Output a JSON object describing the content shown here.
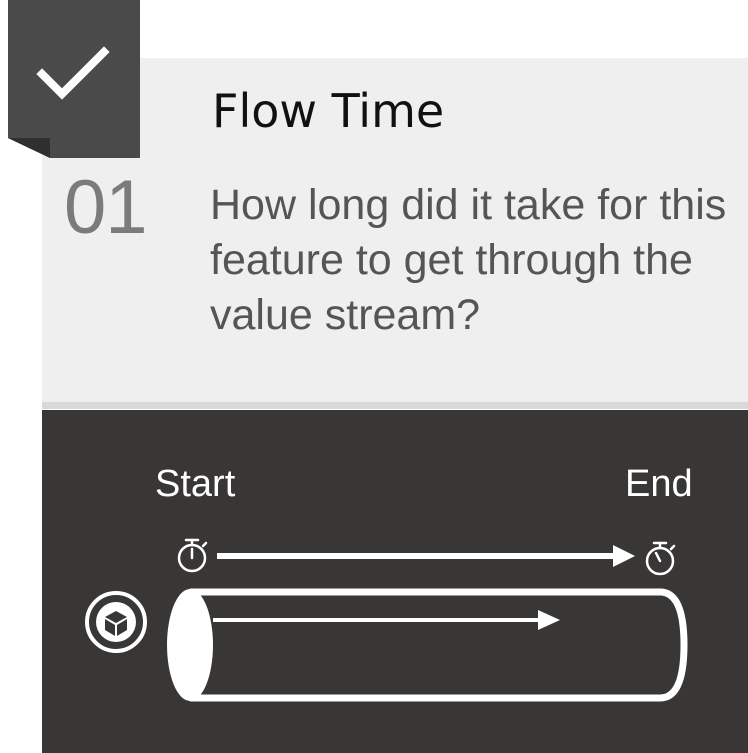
{
  "card": {
    "title": "Flow Time",
    "step_number": "01",
    "question": "How long did it take for this feature to get through the value stream?"
  },
  "diagram": {
    "start_label": "Start",
    "end_label": "End"
  },
  "colors": {
    "badge": "#4a4a4a",
    "badge_fold": "#2f2f2f",
    "card_background": "#efefef",
    "dark_panel": "#393736",
    "stroke": "#ffffff"
  },
  "icons": {
    "badge": "checkmark-icon",
    "start": "stopwatch-icon",
    "end": "stopwatch-icon",
    "item": "cube-icon"
  }
}
